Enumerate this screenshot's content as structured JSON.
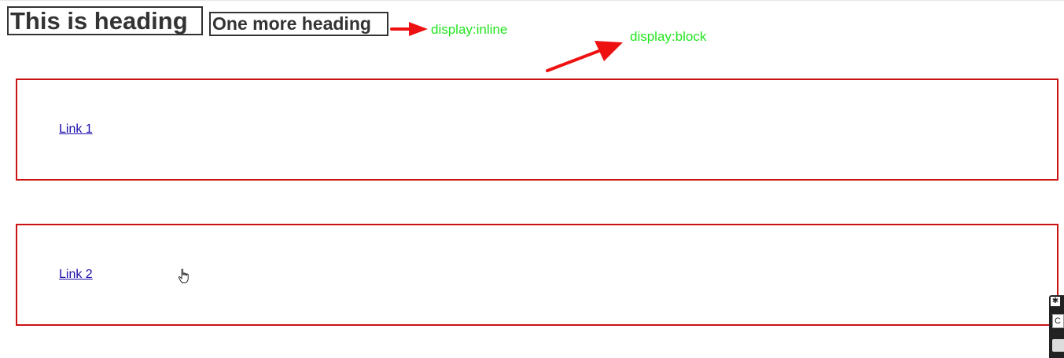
{
  "headings": {
    "primary": "This is heading",
    "secondary": "One more heading"
  },
  "annotations": {
    "inline_note": "display:inline",
    "block_note": "display:block",
    "color": "#22e61e",
    "arrow_color": "#ee1111"
  },
  "links": [
    {
      "label": "Link 1"
    },
    {
      "label": "Link 2"
    }
  ],
  "link_box_border_color": "#cc1111",
  "link_color": "#1a0dab",
  "cursor_icon": "hand-pointer-icon",
  "side_widget": {
    "pin_icon": "pin-icon",
    "field_value": "C"
  }
}
